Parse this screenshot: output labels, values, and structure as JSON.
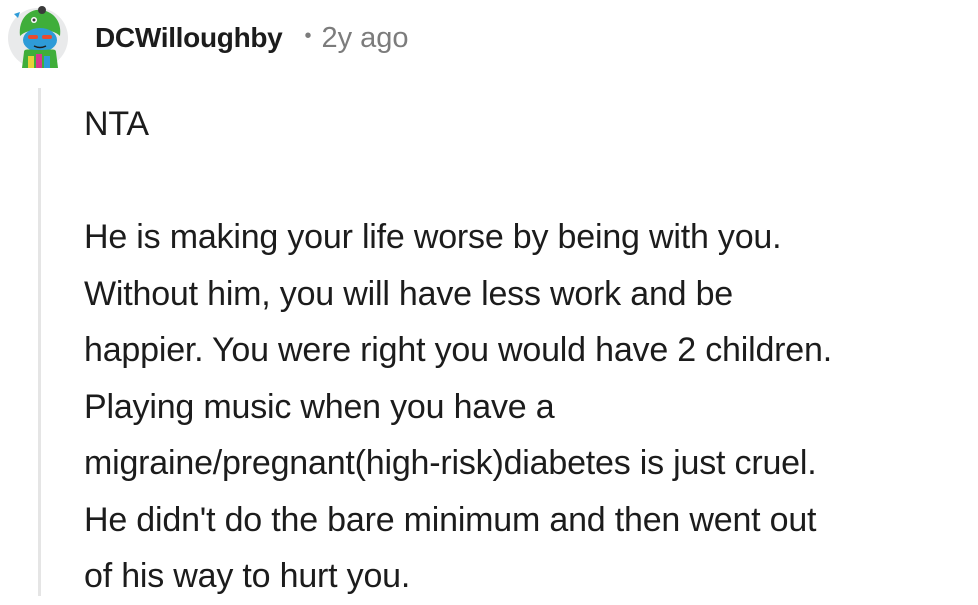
{
  "comment": {
    "author": "DCWilloughby",
    "separator": "•",
    "age": "2y ago",
    "avatar_icon": "snoo-avatar-icon",
    "verdict": "NTA",
    "body_lines": [
      "He is making your life worse by being with you.",
      "Without him, you will have less work and be",
      "happier. You were right you would have 2 children.",
      "Playing music when you have a",
      "migraine/pregnant(high-risk)diabetes is just cruel.",
      "He didn't do the bare minimum and then went out",
      "of his way to hurt you."
    ]
  },
  "colors": {
    "text": "#1c1c1c",
    "meta": "#7c7c7c",
    "thread_line": "#e5e5e5",
    "avatar_bg": "#e9eaeb",
    "avatar_hat": "#3fae3a",
    "avatar_face": "#2e9bd8"
  }
}
